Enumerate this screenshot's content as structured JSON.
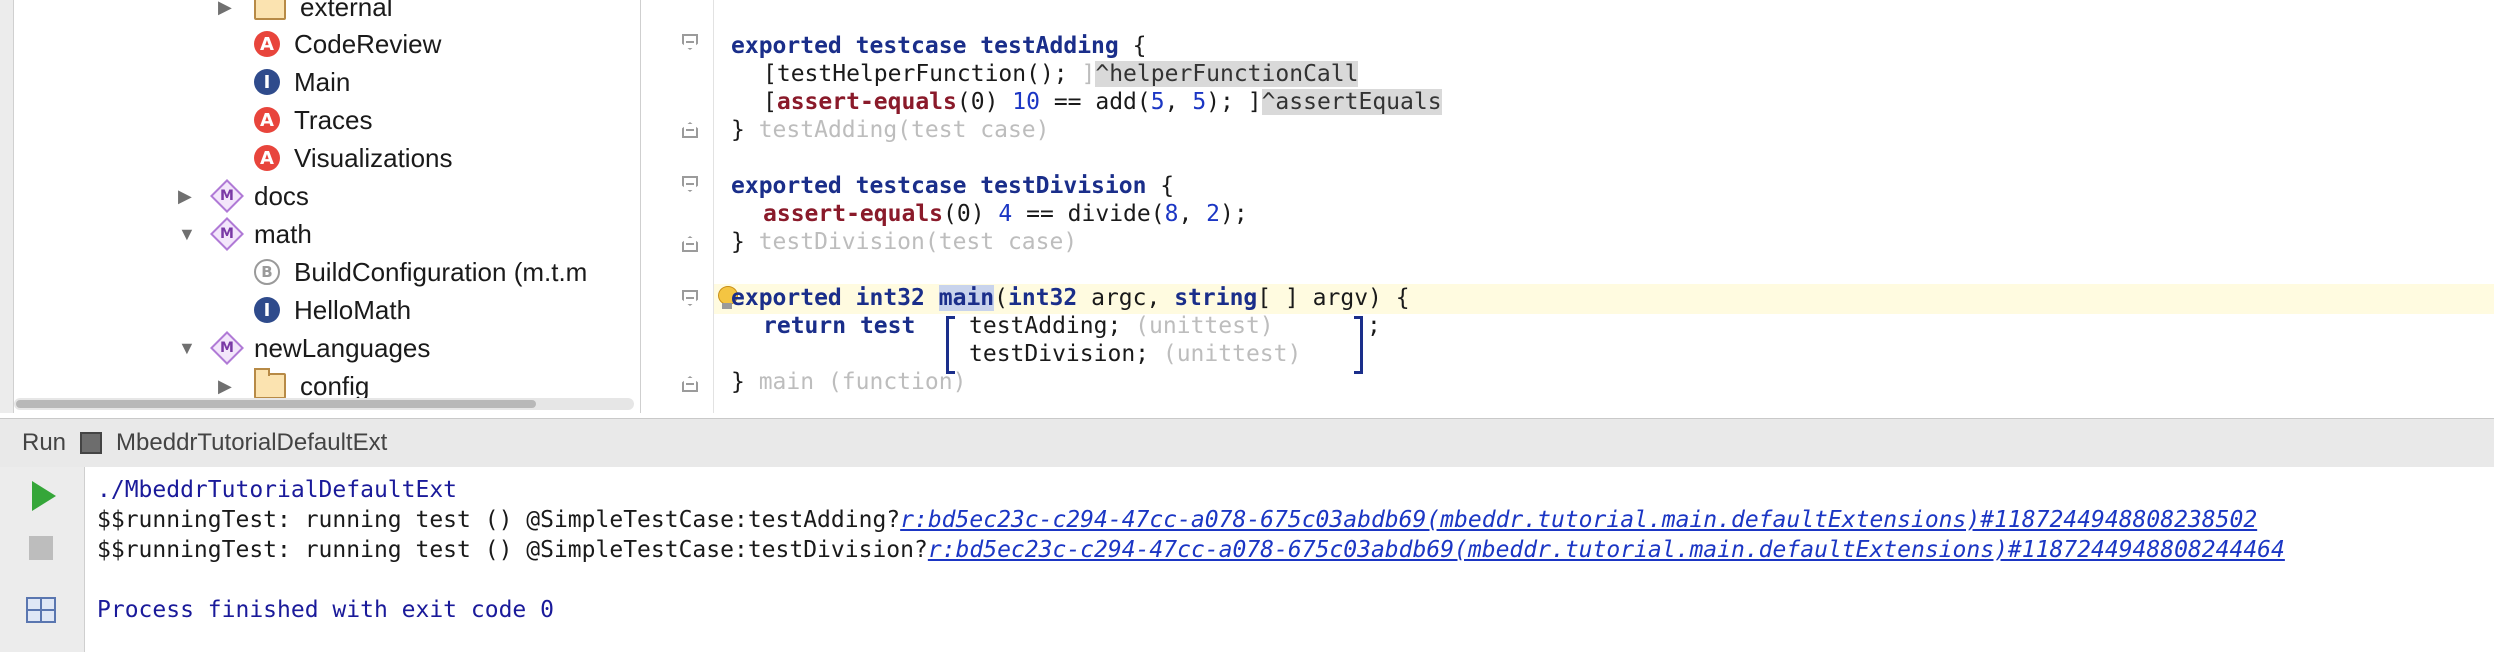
{
  "tree": {
    "items": [
      {
        "label": "external",
        "icon": "folder-icon",
        "arrow": "▶"
      },
      {
        "label": "CodeReview",
        "icon": "A"
      },
      {
        "label": "Main",
        "icon": "I"
      },
      {
        "label": "Traces",
        "icon": "A"
      },
      {
        "label": "Visualizations",
        "icon": "A"
      },
      {
        "label": "docs",
        "icon": "M",
        "arrow": "▶"
      },
      {
        "label": "math",
        "icon": "M",
        "arrow": "▼"
      },
      {
        "label": "BuildConfiguration (m.t.m",
        "icon": "B"
      },
      {
        "label": "HelloMath",
        "icon": "I"
      },
      {
        "label": "newLanguages",
        "icon": "M",
        "arrow": "▼"
      },
      {
        "label": "config",
        "icon": "folder-icon",
        "arrow": "▶"
      }
    ]
  },
  "editor": {
    "test_adding": {
      "kw1": "exported",
      "kw2": "testcase",
      "name": "testAdding",
      "brace": " {",
      "call_open": "[",
      "call_text": "testHelperFunction();",
      "call_close": " ]",
      "call_ref": "^helperFunctionCall",
      "assert_open": "[",
      "assert_kw": "assert-equals",
      "assert_arg": "(0) ",
      "n10": "10",
      "eq": " == add(",
      "n5a": "5",
      "comma": ", ",
      "n5b": "5",
      "assert_tail": "); ]",
      "assert_ref": "^assertEquals",
      "close": "} ",
      "close_hint": "testAdding(test case)"
    },
    "test_division": {
      "kw1": "exported",
      "kw2": "testcase",
      "name": "testDivision",
      "brace": " {",
      "assert_kw": "assert-equals",
      "assert_arg": "(0) ",
      "n4": "4",
      "eq": " == divide(",
      "n8": "8",
      "comma": ", ",
      "n2": "2",
      "tail": ");",
      "close": "} ",
      "close_hint": "testDivision(test case)"
    },
    "main_fn": {
      "kw1": "exported",
      "kw2": "int32",
      "name": "main",
      "p1": "(",
      "kw3": "int32",
      "p2": " argc, ",
      "kw4": "string",
      "p3": "[ ] argv) {",
      "ret_kw": "return",
      "test_kw": "test",
      "item1": "testAdding;",
      "item1_hint": " (unittest)",
      "item2": "testDivision;",
      "item2_hint": " (unittest)",
      "semi": ";",
      "close": "} ",
      "close_hint": "main (function)"
    }
  },
  "run": {
    "tab_label": "Run",
    "config_name": "MbeddrTutorialDefaultExt",
    "console": {
      "line1": "./MbeddrTutorialDefaultExt",
      "line2_prefix": "$$runningTest: running test () @SimpleTestCase:testAdding?",
      "line2_link": "r:bd5ec23c-c294-47cc-a078-675c03abdb69(mbeddr.tutorial.main.defaultExtensions)#1187244948808238502",
      "line3_prefix": "$$runningTest: running test () @SimpleTestCase:testDivision?",
      "line3_link": "r:bd5ec23c-c294-47cc-a078-675c03abdb69(mbeddr.tutorial.main.defaultExtensions)#1187244948808244464",
      "line5": "Process finished with exit code 0"
    }
  },
  "colors": {
    "keyword": "#1a2e8a",
    "assert": "#8a1a2a",
    "number": "#1b36c4",
    "hint": "#bdbdbd",
    "caret_line": "#fffbe0",
    "run_icon": "#35a639"
  }
}
